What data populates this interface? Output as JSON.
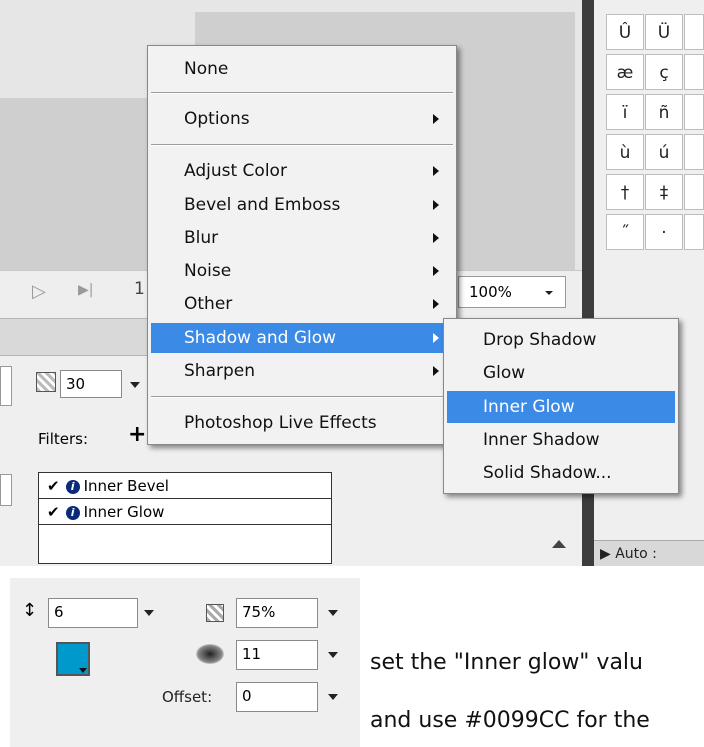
{
  "glyphs": [
    "Û",
    "Ü",
    "æ",
    "ç",
    "ï",
    "ñ",
    "ù",
    "ú",
    "†",
    "‡",
    "˝",
    "·"
  ],
  "timeline": {
    "play_glyph": "▷",
    "step_glyph": "▶|",
    "frame_label": "1",
    "zoom_value": "100%"
  },
  "properties": {
    "blur_value": "30",
    "filters_label": "Filters:",
    "add_filter_glyph": "+",
    "filters": [
      {
        "check": "✔",
        "info": "i",
        "name": "Inner Bevel"
      },
      {
        "check": "✔",
        "info": "i",
        "name": "Inner Glow"
      }
    ]
  },
  "context_menu": {
    "items": [
      {
        "label": "None",
        "has_submenu": false
      },
      {
        "label": "Options",
        "has_submenu": true
      },
      {
        "label": "Adjust Color",
        "has_submenu": true
      },
      {
        "label": "Bevel and Emboss",
        "has_submenu": true
      },
      {
        "label": "Blur",
        "has_submenu": true
      },
      {
        "label": "Noise",
        "has_submenu": true
      },
      {
        "label": "Other",
        "has_submenu": true
      },
      {
        "label": "Shadow and Glow",
        "has_submenu": true,
        "highlighted": true
      },
      {
        "label": "Sharpen",
        "has_submenu": true
      },
      {
        "label": "Photoshop Live Effects",
        "has_submenu": false
      }
    ]
  },
  "submenu": {
    "items": [
      {
        "label": "Drop Shadow"
      },
      {
        "label": "Glow"
      },
      {
        "label": "Inner Glow",
        "highlighted": true
      },
      {
        "label": "Inner Shadow"
      },
      {
        "label": "Solid Shadow..."
      }
    ]
  },
  "auto_bar": {
    "label": "▶ Auto :"
  },
  "inner_glow_settings": {
    "width_value": "6",
    "opacity_value": "75%",
    "softness_value": "11",
    "offset_label": "Offset:",
    "offset_value": "0",
    "swatch_color": "#0099CC"
  },
  "instructions": {
    "line1": "set the \"Inner glow\" valu",
    "line2": "and use #0099CC for the"
  },
  "colors": {
    "menu_highlight": "#3b8ae6",
    "swatch": "#0099CC"
  }
}
